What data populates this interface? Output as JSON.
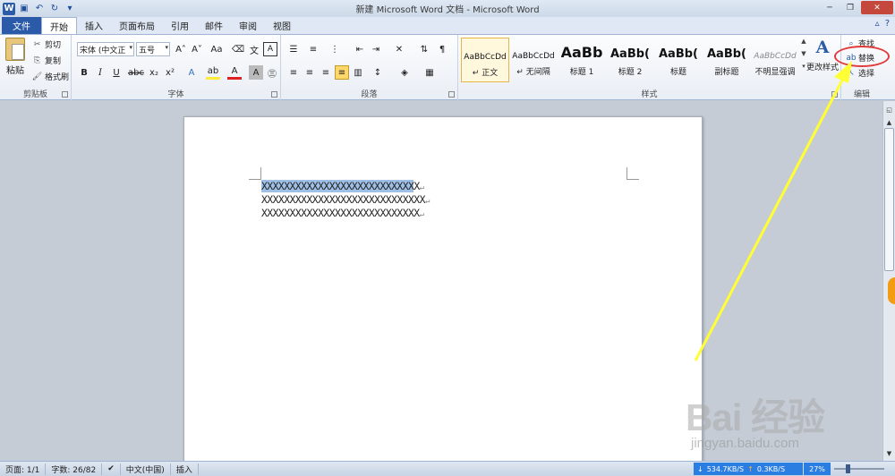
{
  "titlebar": {
    "title": "新建 Microsoft Word 文档 - Microsoft Word",
    "app_icon": "W"
  },
  "tabs": [
    {
      "label": "文件"
    },
    {
      "label": "开始"
    },
    {
      "label": "插入"
    },
    {
      "label": "页面布局"
    },
    {
      "label": "引用"
    },
    {
      "label": "邮件"
    },
    {
      "label": "审阅"
    },
    {
      "label": "视图"
    }
  ],
  "ribbon": {
    "clipboard": {
      "label": "剪贴板",
      "paste": "粘贴",
      "cut": "剪切",
      "copy": "复制",
      "format_painter": "格式刷"
    },
    "font": {
      "label": "字体",
      "font_name": "宋体 (中文正",
      "font_size": "五号"
    },
    "paragraph": {
      "label": "段落"
    },
    "styles": {
      "label": "样式",
      "items": [
        {
          "preview": "AaBbCcDd",
          "name": "↵ 正文"
        },
        {
          "preview": "AaBbCcDd",
          "name": "↵ 无间隔"
        },
        {
          "preview": "AaBb",
          "name": "标题 1"
        },
        {
          "preview": "AaBb(",
          "name": "标题 2"
        },
        {
          "preview": "AaBb(",
          "name": "标题"
        },
        {
          "preview": "AaBb(",
          "name": "副标题"
        },
        {
          "preview": "AaBbCcDd",
          "name": "不明显强调"
        }
      ],
      "change_styles": "更改样式"
    },
    "editing": {
      "label": "编辑",
      "find": "查找",
      "replace": "替换",
      "select": "选择"
    }
  },
  "document": {
    "lines": [
      {
        "selected": "XXXXXXXXXXXXXXXXXXXXXXXXXXX",
        "rest": "X",
        "mark": "↵"
      },
      {
        "selected": "",
        "rest": "XXXXXXXXXXXXXXXXXXXXXXXXXXXXX",
        "mark": "↵"
      },
      {
        "selected": "",
        "rest": "XXXXXXXXXXXXXXXXXXXXXXXXXXXX",
        "mark": "↵"
      }
    ]
  },
  "status": {
    "page": "页面: 1/1",
    "words": "字数: 26/82",
    "language": "中文(中国)",
    "mode": "插入",
    "download": "534.7KB/S",
    "upload": "0.3KB/S",
    "zoom": "27%"
  },
  "watermark": {
    "brand": "Bai 经验",
    "url": "jingyan.baidu.com"
  },
  "colors": {
    "accent": "#2a5aa8",
    "selection": "#9fc0e6",
    "annotation_red": "#e23a3a",
    "annotation_arrow": "#ffff33"
  }
}
